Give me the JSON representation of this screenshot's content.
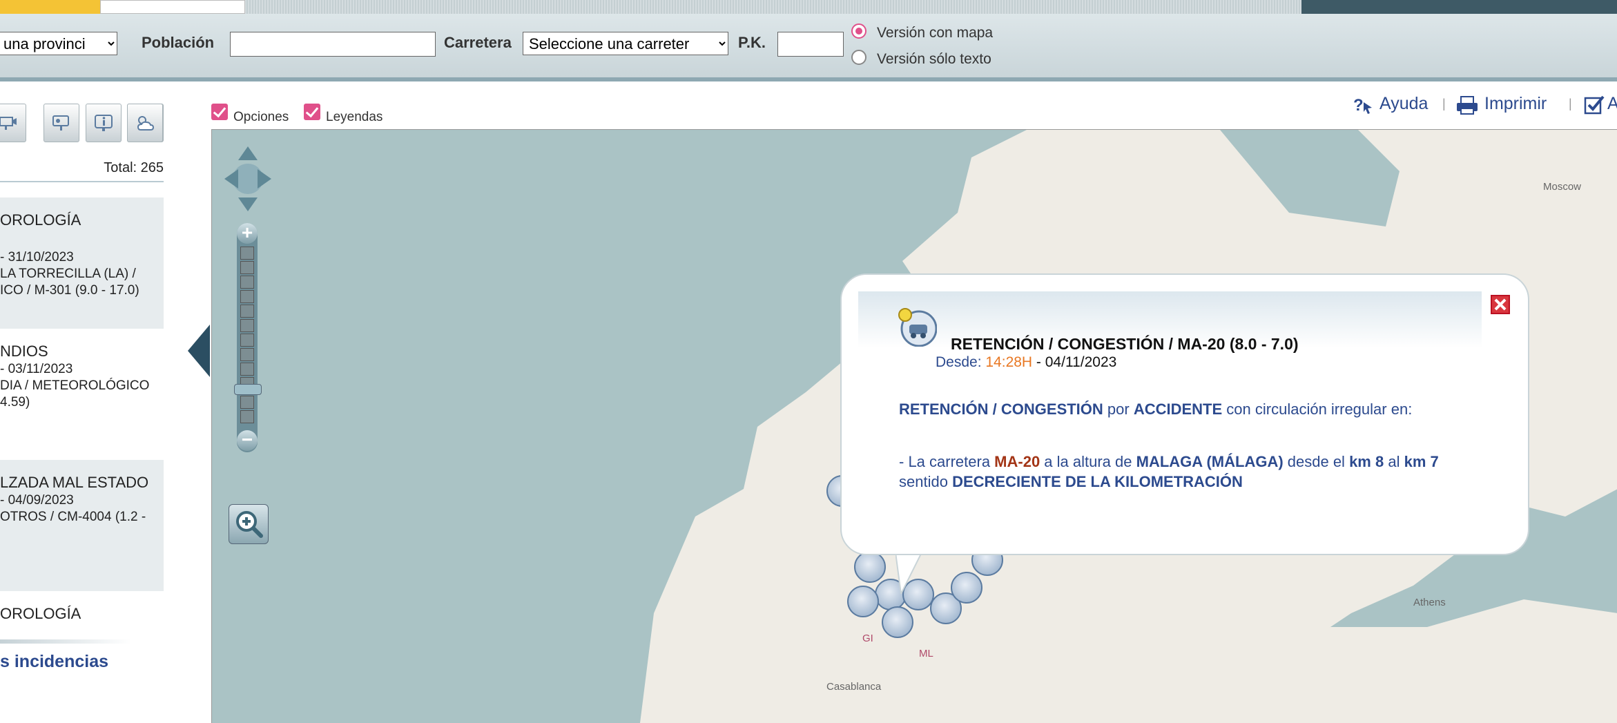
{
  "filters": {
    "province_value": "una provinci",
    "poblacion_label": "Población",
    "poblacion_value": "",
    "carretera_label": "Carretera",
    "carretera_value": "Seleccione una carreter",
    "pk_label": "P.K.",
    "pk_value": "",
    "version_map_label": "Versión con mapa",
    "version_text_label": "Versión sólo texto"
  },
  "toolbar_icons": [
    "camera-icon",
    "panel-icon",
    "info-icon",
    "signal-icon",
    "weather-icon"
  ],
  "total_label": "Total: 265",
  "incidents": [
    {
      "title": "OROLOGÍA",
      "lines": [
        "- 31/10/2023",
        "LA TORRECILLA (LA) /",
        "ICO / M-301 (9.0 - 17.0)"
      ]
    },
    {
      "title": "NDIOS",
      "lines": [
        "- 03/11/2023",
        "DIA / METEOROLÓGICO",
        "4.59)"
      ]
    },
    {
      "title": "LZADA MAL ESTADO",
      "lines": [
        "- 04/09/2023",
        "OTROS / CM-4004 (1.2 -",
        ""
      ]
    },
    {
      "title": "OROLOGÍA",
      "lines": []
    }
  ],
  "more_link": "s incidencias",
  "options": {
    "opciones_label": "Opciones",
    "leyendas_label": "Leyendas"
  },
  "header_links": {
    "ayuda": "Ayuda",
    "imprimir": "Imprimir",
    "sep": "|",
    "partial": "A"
  },
  "map_labels": {
    "moscow": "Moscow",
    "athens": "Athens",
    "casablanca": "Casablanca",
    "gi": "GI",
    "ml": "ML"
  },
  "popup": {
    "title": "RETENCIÓN / CONGESTIÓN / MA-20 (8.0 - 7.0)",
    "since_label": "Desde: ",
    "since_time": "14:28H",
    "since_date": " - 04/11/2023",
    "p1_type": "RETENCIÓN / CONGESTIÓN",
    "p1_por": " por ",
    "p1_cause": "ACCIDENTE",
    "p1_rest": " con circulación irregular en:",
    "p2_intro": "- La carretera ",
    "p2_road": "MA-20",
    "p2_a": " a la altura de ",
    "p2_place": "MALAGA (MÁLAGA)",
    "p2_desde": " desde el ",
    "p2_km_from": "km 8",
    "p2_al": " al ",
    "p2_km_to": "km 7",
    "p2_sentido": " sentido ",
    "p2_direction": "DECRECIENTE DE LA KILOMETRACIÓN"
  },
  "colors": {
    "accent_pink": "#e0508a",
    "link_blue": "#2c4a8e",
    "road_red": "#a33516",
    "time_orange": "#e87722"
  }
}
